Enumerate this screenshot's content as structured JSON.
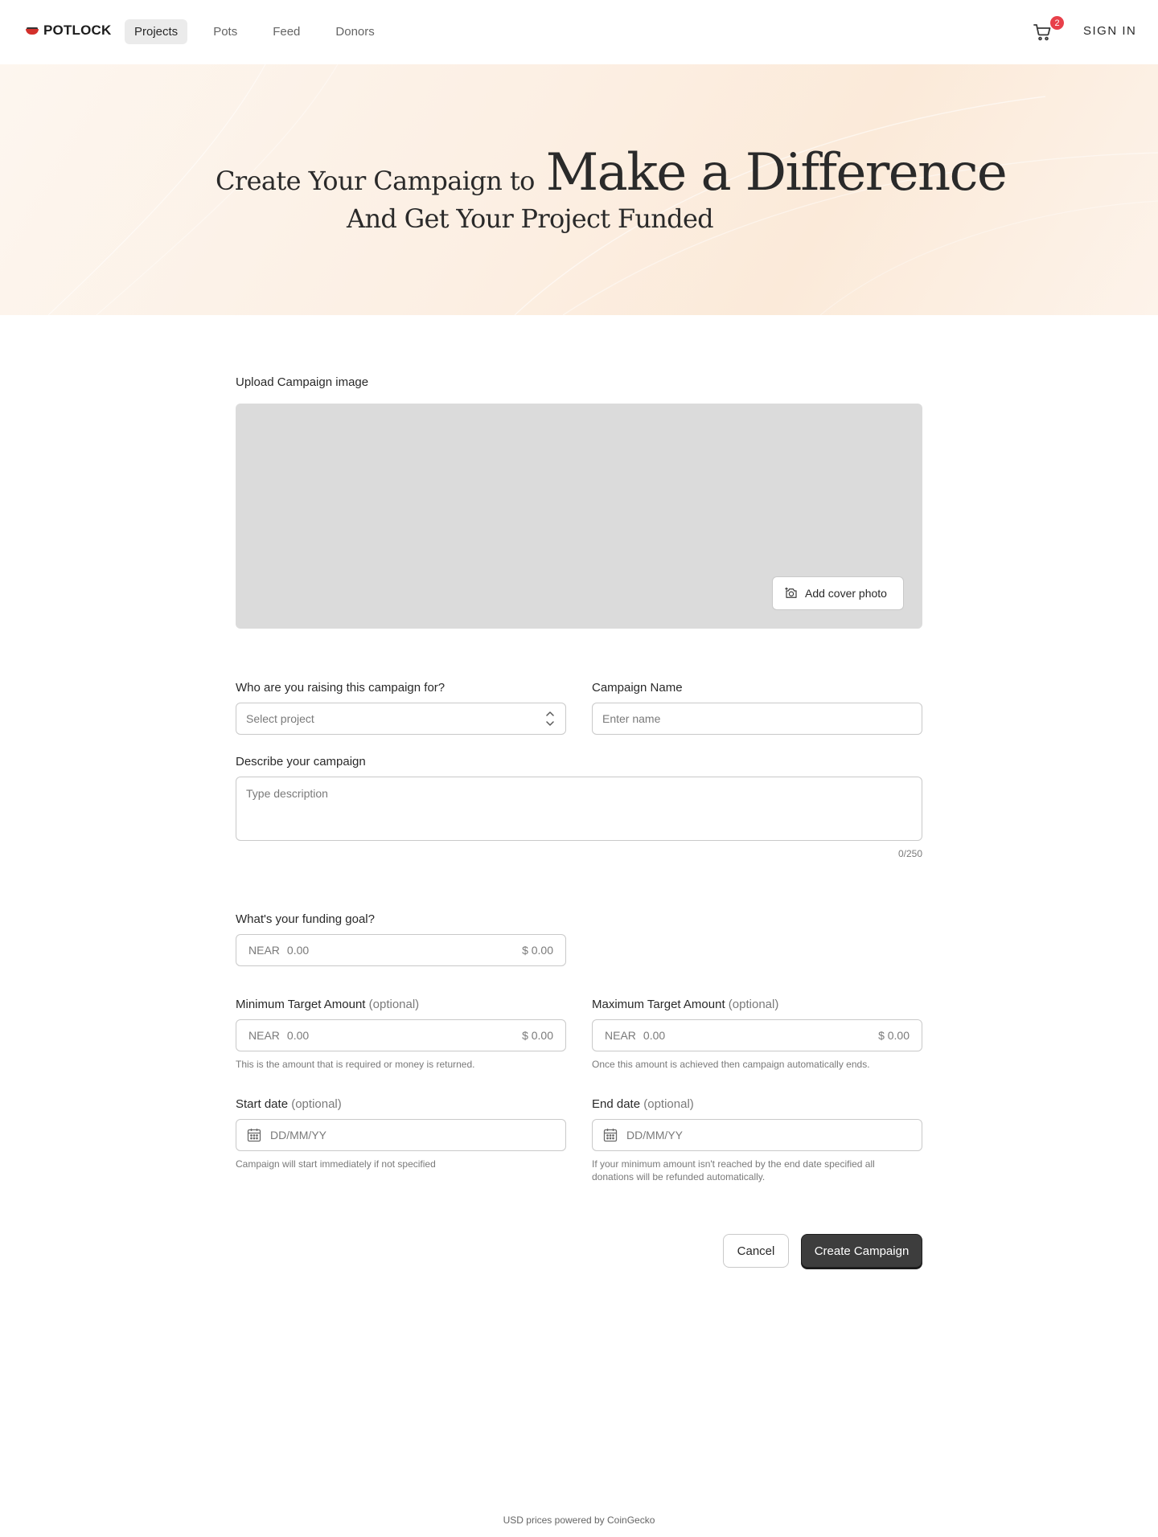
{
  "nav": {
    "logo": "POTLOCK",
    "links": [
      "Projects",
      "Pots",
      "Feed",
      "Donors"
    ],
    "active_link": "Projects",
    "cart_count": "2",
    "sign_in": "SIGN IN"
  },
  "hero": {
    "line1_small": "Create Your Campaign to",
    "line1_big": "Make a Difference",
    "line2": "And Get Your Project Funded"
  },
  "upload": {
    "label": "Upload Campaign image",
    "cover_button": "Add cover photo"
  },
  "form": {
    "project": {
      "label": "Who are you raising this campaign for?",
      "placeholder": "Select project"
    },
    "name": {
      "label": "Campaign Name",
      "placeholder": "Enter name"
    },
    "description": {
      "label": "Describe your campaign",
      "placeholder": "Type description",
      "counter": "0/250"
    },
    "goal": {
      "label": "What's your funding goal?",
      "unit": "NEAR",
      "placeholder": "0.00",
      "usd": "$ 0.00"
    },
    "min_target": {
      "label": "Minimum Target Amount",
      "optional": "(optional)",
      "unit": "NEAR",
      "placeholder": "0.00",
      "usd": "$ 0.00",
      "hint": "This is the amount that is required or money is returned."
    },
    "max_target": {
      "label": "Maximum Target Amount",
      "optional": "(optional)",
      "unit": "NEAR",
      "placeholder": "0.00",
      "usd": "$ 0.00",
      "hint": "Once this amount is achieved then campaign automatically ends."
    },
    "start_date": {
      "label": "Start date",
      "optional": "(optional)",
      "placeholder": "DD/MM/YY",
      "hint": "Campaign will start immediately if not specified"
    },
    "end_date": {
      "label": "End date",
      "optional": "(optional)",
      "placeholder": "DD/MM/YY",
      "hint": "If your minimum amount isn't reached by the end date specified all donations will be refunded automatically."
    }
  },
  "actions": {
    "cancel": "Cancel",
    "create": "Create Campaign"
  },
  "footer": "USD prices powered by CoinGecko",
  "colors": {
    "badge": "#e8404a",
    "primary_button": "#3d3d3d",
    "hero_bg": "#fcefe3",
    "upload_bg": "#dbdbdb"
  }
}
